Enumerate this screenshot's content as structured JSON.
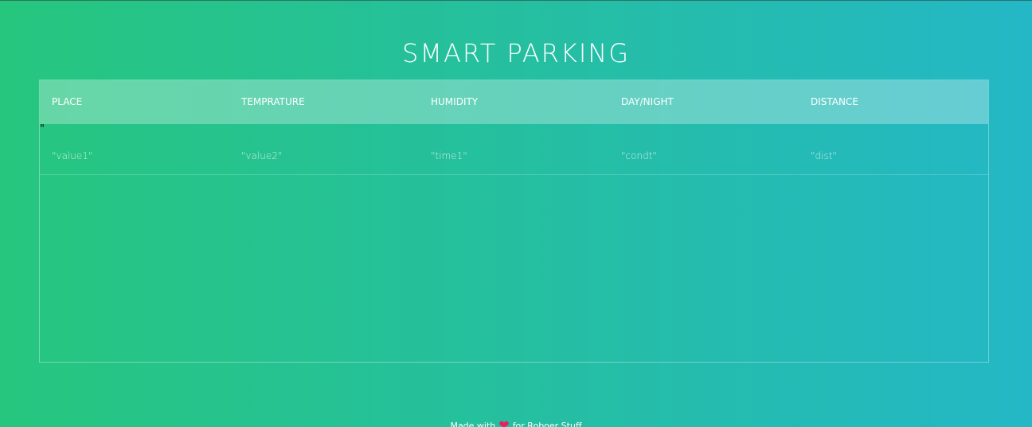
{
  "page": {
    "title": "SMART PARKING"
  },
  "table": {
    "headers": [
      "PLACE",
      "TEMPRATURE",
      "HUMIDITY",
      "DAY/NIGHT",
      "DISTANCE"
    ],
    "stray_text": "\"",
    "rows": [
      [
        "\"value1\"",
        "\"value2\"",
        "\"time1\"",
        "\"condt\"",
        "\"dist\""
      ]
    ]
  },
  "footer": {
    "prefix": "Made with",
    "heart_icon": "heart-icon",
    "suffix": "for Roboer Stuff"
  },
  "colors": {
    "gradient_start": "#26c67e",
    "gradient_end": "#24b7c6",
    "heart": "#e91e63"
  }
}
